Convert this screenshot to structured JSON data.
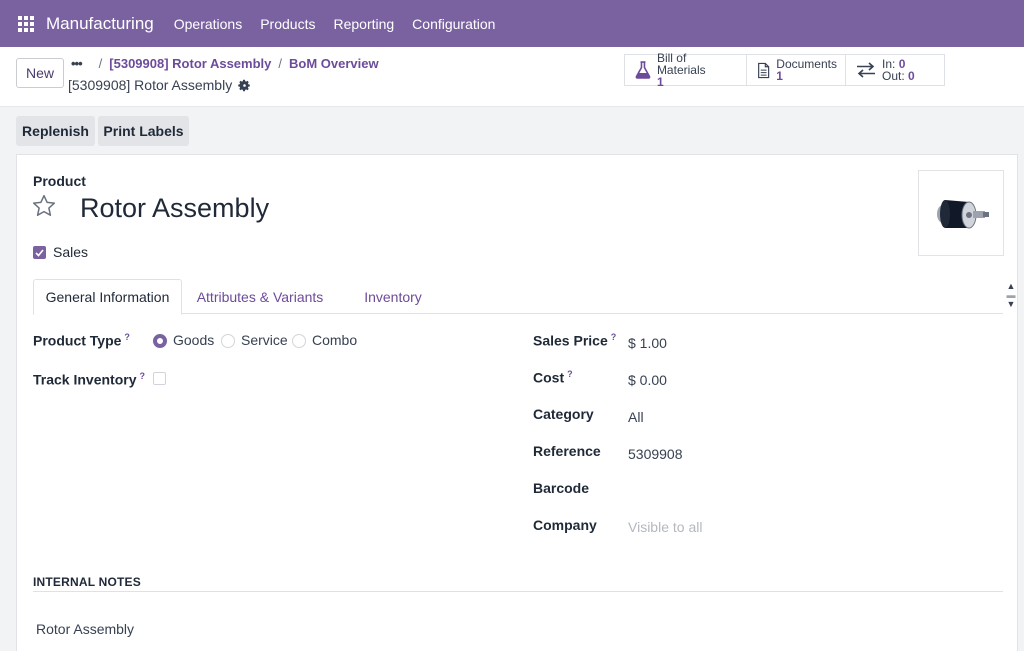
{
  "navbar": {
    "brand": "Manufacturing",
    "menu": [
      "Operations",
      "Products",
      "Reporting",
      "Configuration"
    ]
  },
  "control": {
    "new_label": "New",
    "breadcrumb": {
      "dots": "•••",
      "sep": "/",
      "items": [
        "[5309908] Rotor Assembly",
        "BoM Overview"
      ]
    },
    "record_title": "[5309908] Rotor Assembly",
    "smart_buttons": {
      "bom": {
        "label": "Bill of Materials",
        "value": "1"
      },
      "documents": {
        "label": "Documents",
        "value": "1"
      },
      "inout": {
        "in_label": "In:",
        "in_value": "0",
        "out_label": "Out:",
        "out_value": "0"
      }
    }
  },
  "actions": {
    "replenish": "Replenish",
    "print_labels": "Print Labels"
  },
  "form": {
    "product_label": "Product",
    "product_name": "Rotor Assembly",
    "sales_label": "Sales",
    "tabs": [
      "General Information",
      "Attributes & Variants",
      "Inventory"
    ],
    "left_fields": {
      "product_type": {
        "label": "Product Type",
        "help": "?",
        "options": [
          "Goods",
          "Service",
          "Combo"
        ],
        "selected": "Goods"
      },
      "track_inventory": {
        "label": "Track Inventory",
        "help": "?"
      }
    },
    "right_fields": {
      "sales_price": {
        "label": "Sales Price",
        "help": "?",
        "value": "$ 1.00"
      },
      "cost": {
        "label": "Cost",
        "help": "?",
        "value": "$ 0.00"
      },
      "category": {
        "label": "Category",
        "value": "All"
      },
      "reference": {
        "label": "Reference",
        "value": "5309908"
      },
      "barcode": {
        "label": "Barcode",
        "value": ""
      },
      "company": {
        "label": "Company",
        "placeholder": "Visible to all"
      }
    },
    "notes_title": "INTERNAL NOTES",
    "notes_text": "Rotor Assembly"
  },
  "colors": {
    "brand": "#7a62a1",
    "link": "#6c4c9a"
  }
}
